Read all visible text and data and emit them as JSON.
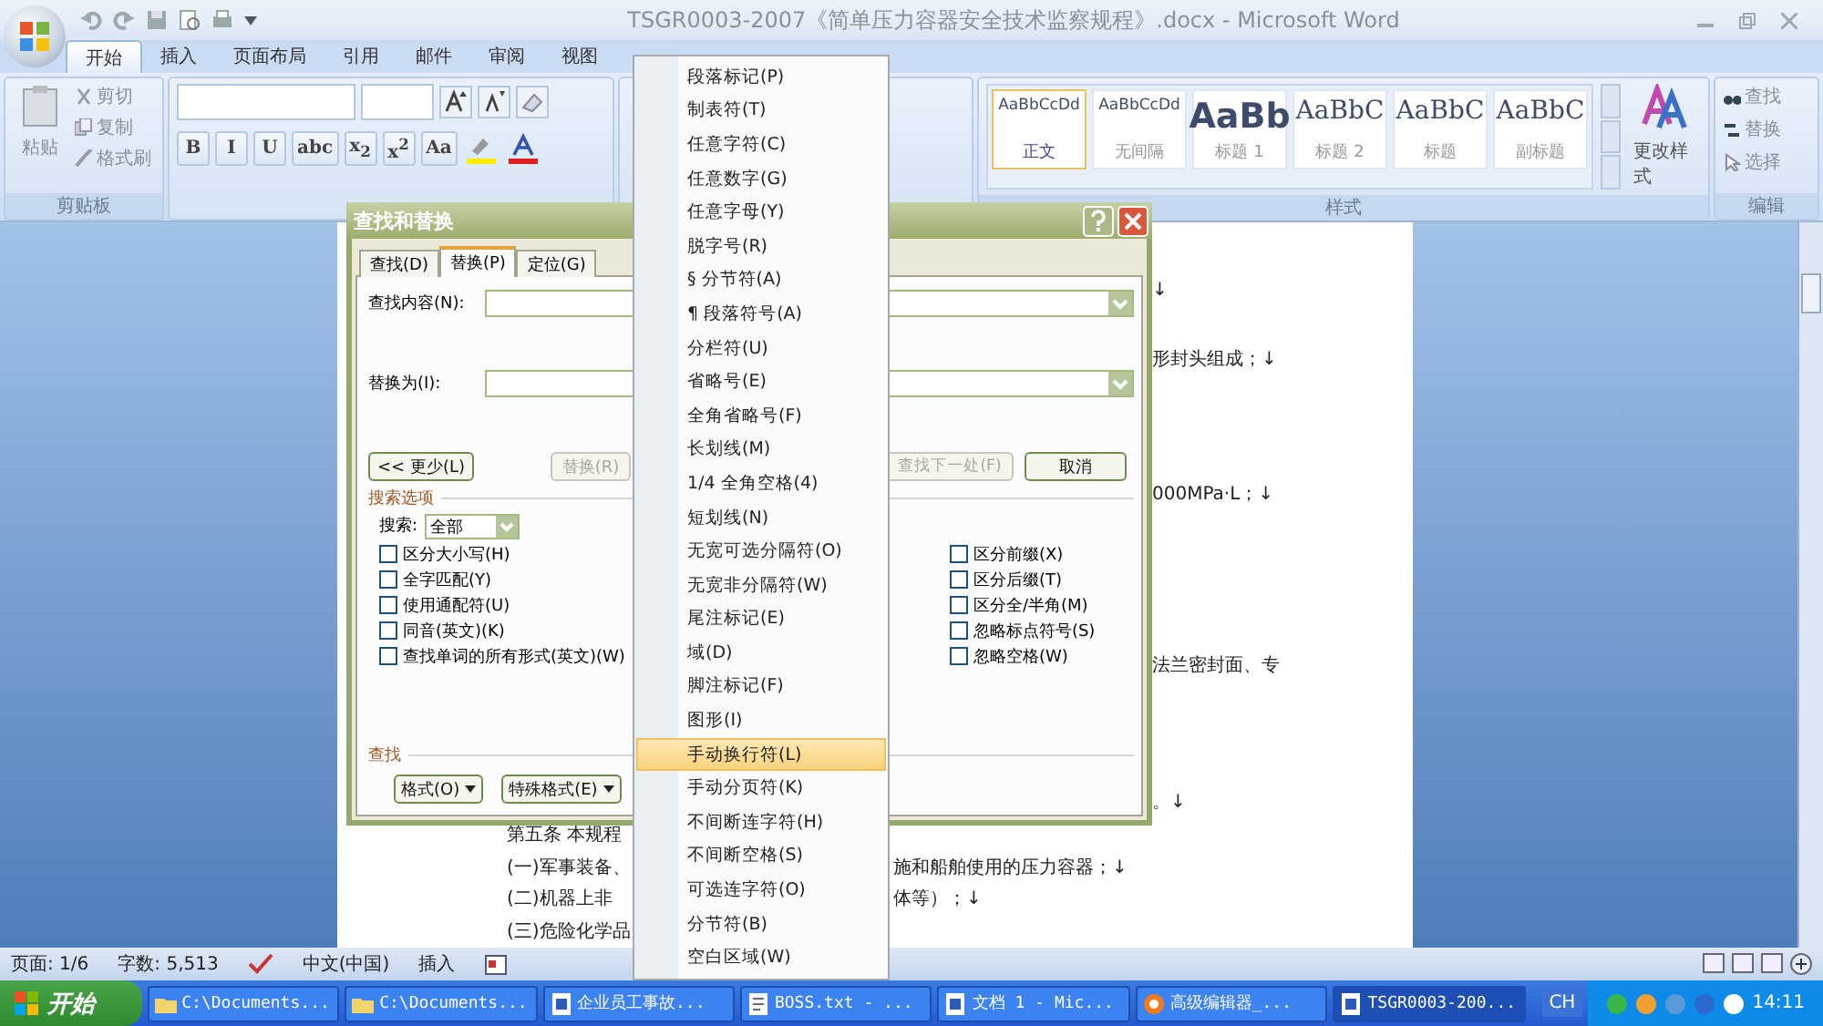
{
  "window": {
    "title": "TSGR0003-2007《简单压力容器安全技术监察规程》.docx - Microsoft Word"
  },
  "ribbon_tabs": [
    {
      "label": "开始",
      "selected": true
    },
    {
      "label": "插入",
      "selected": false
    },
    {
      "label": "页面布局",
      "selected": false
    },
    {
      "label": "引用",
      "selected": false
    },
    {
      "label": "邮件",
      "selected": false
    },
    {
      "label": "审阅",
      "selected": false
    },
    {
      "label": "视图",
      "selected": false
    }
  ],
  "clipboard": {
    "paste": "粘贴",
    "items": [
      "剪切",
      "复制",
      "格式刷"
    ],
    "label": "剪贴板"
  },
  "font": {
    "format_buttons": [
      "B",
      "I",
      "U",
      "abc",
      "x$_{2}$",
      "x$^{2}$",
      "Aa"
    ]
  },
  "styles": {
    "items": [
      {
        "preview": "AaBbCcDd",
        "name": "正文",
        "selected": true
      },
      {
        "preview": "AaBbCcDd",
        "name": "无间隔",
        "selected": false
      },
      {
        "preview": "AaBb",
        "name": "标题 1",
        "selected": false
      },
      {
        "preview": "AaBbC",
        "name": "标题 2",
        "selected": false
      },
      {
        "preview": "AaBbC",
        "name": "标题",
        "selected": false
      },
      {
        "preview": "AaBbC",
        "name": "副标题",
        "selected": false
      }
    ],
    "change": "更改样式",
    "label": "样式"
  },
  "editing": {
    "items": [
      "查找",
      "替换",
      "选择"
    ],
    "label": "编辑"
  },
  "document": {
    "lines": [
      {
        "kind": "right",
        "text": "↓"
      },
      {
        "kind": "right",
        "text": "形封头组成；↓"
      },
      {
        "kind": "right",
        "text": "000MPa·L；↓"
      },
      {
        "kind": "right",
        "text": "法兰密封面、专"
      },
      {
        "kind": "right",
        "text": "。↓"
      },
      {
        "kind": "left",
        "text": "第五条  本规程"
      },
      {
        "kind": "split",
        "text": "(一)军事装备、",
        "rest": "施和船舶使用的压力容器；↓"
      },
      {
        "kind": "split",
        "text": "(二)机器上非",
        "rest": "体等）；↓"
      },
      {
        "kind": "left",
        "text": "(三)危险化学品"
      }
    ]
  },
  "dialog": {
    "title": "查找和替换",
    "tabs": [
      {
        "label": "查找(D)",
        "selected": false
      },
      {
        "label": "替换(P)",
        "selected": true
      },
      {
        "label": "定位(G)",
        "selected": false
      }
    ],
    "find_label": "查找内容(N):",
    "replace_label": "替换为(I):",
    "buttons": [
      {
        "label": "<< 更少(L)",
        "disabled": false
      },
      {
        "label": "替换(R)",
        "disabled": true
      },
      {
        "label": "查找下一处(F)",
        "disabled": true
      },
      {
        "label": "取消",
        "disabled": false
      }
    ],
    "options_title": "搜索选项",
    "search_label": "搜索:",
    "search_value": "全部",
    "options_left": [
      {
        "label": "区分大小写(H)",
        "checked": false
      },
      {
        "label": "全字匹配(Y)",
        "checked": false
      },
      {
        "label": "使用通配符(U)",
        "checked": false
      },
      {
        "label": "同音(英文)(K)",
        "checked": false
      },
      {
        "label": "查找单词的所有形式(英文)(W)",
        "checked": false
      }
    ],
    "options_right": [
      {
        "label": "区分前缀(X)",
        "checked": false
      },
      {
        "label": "区分后缀(T)",
        "checked": false
      },
      {
        "label": "区分全/半角(M)",
        "checked": false
      },
      {
        "label": "忽略标点符号(S)",
        "checked": false
      },
      {
        "label": "忽略空格(W)",
        "checked": false
      }
    ],
    "find_title": "查找",
    "bottom_buttons": [
      "格式(O)",
      "特殊格式(E)"
    ]
  },
  "special_menu": {
    "items": [
      {
        "label": "段落标记(P)",
        "selected": false
      },
      {
        "label": "制表符(T)",
        "selected": false
      },
      {
        "label": "任意字符(C)",
        "selected": false
      },
      {
        "label": "任意数字(G)",
        "selected": false
      },
      {
        "label": "任意字母(Y)",
        "selected": false
      },
      {
        "label": "脱字号(R)",
        "selected": false
      },
      {
        "label": "§ 分节符(A)",
        "selected": false
      },
      {
        "label": "¶ 段落符号(A)",
        "selected": false
      },
      {
        "label": "分栏符(U)",
        "selected": false
      },
      {
        "label": "省略号(E)",
        "selected": false
      },
      {
        "label": "全角省略号(F)",
        "selected": false
      },
      {
        "label": "长划线(M)",
        "selected": false
      },
      {
        "label": "1/4 全角空格(4)",
        "selected": false
      },
      {
        "label": "短划线(N)",
        "selected": false
      },
      {
        "label": "无宽可选分隔符(O)",
        "selected": false
      },
      {
        "label": "无宽非分隔符(W)",
        "selected": false
      },
      {
        "label": "尾注标记(E)",
        "selected": false
      },
      {
        "label": "域(D)",
        "selected": false
      },
      {
        "label": "脚注标记(F)",
        "selected": false
      },
      {
        "label": "图形(I)",
        "selected": false
      },
      {
        "label": "手动换行符(L)",
        "selected": true
      },
      {
        "label": "手动分页符(K)",
        "selected": false
      },
      {
        "label": "不间断连字符(H)",
        "selected": false
      },
      {
        "label": "不间断空格(S)",
        "selected": false
      },
      {
        "label": "可选连字符(O)",
        "selected": false
      },
      {
        "label": "分节符(B)",
        "selected": false
      },
      {
        "label": "空白区域(W)",
        "selected": false
      }
    ]
  },
  "status_bar": {
    "items": [
      "页面: 1/6",
      "字数: 5,513",
      "中文(中国)",
      "插入"
    ]
  },
  "taskbar": {
    "start": "开始",
    "tasks": [
      {
        "label": "C:\\Documents...",
        "selected": false
      },
      {
        "label": "C:\\Documents...",
        "selected": false
      },
      {
        "label": "企业员工事故...",
        "selected": false
      },
      {
        "label": "BOSS.txt - ...",
        "selected": false
      },
      {
        "label": "文档 1 - Mic...",
        "selected": false
      },
      {
        "label": "高级编辑器_...",
        "selected": false
      },
      {
        "label": "TSGR0003-200...",
        "selected": true
      }
    ],
    "lang": "CH",
    "clock": "14:11"
  }
}
